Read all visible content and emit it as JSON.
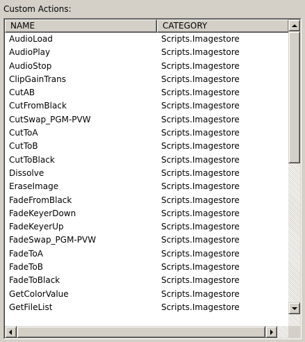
{
  "group_label": "Custom Actions:",
  "columns": {
    "name": "NAME",
    "category": "CATEGORY"
  },
  "rows": [
    {
      "name": "AudioLoad",
      "category": "Scripts.Imagestore"
    },
    {
      "name": "AudioPlay",
      "category": "Scripts.Imagestore"
    },
    {
      "name": "AudioStop",
      "category": "Scripts.Imagestore"
    },
    {
      "name": "ClipGainTrans",
      "category": "Scripts.Imagestore"
    },
    {
      "name": "CutAB",
      "category": "Scripts.Imagestore"
    },
    {
      "name": "CutFromBlack",
      "category": "Scripts.Imagestore"
    },
    {
      "name": "CutSwap_PGM-PVW",
      "category": "Scripts.Imagestore"
    },
    {
      "name": "CutToA",
      "category": "Scripts.Imagestore"
    },
    {
      "name": "CutToB",
      "category": "Scripts.Imagestore"
    },
    {
      "name": "CutToBlack",
      "category": "Scripts.Imagestore"
    },
    {
      "name": "Dissolve",
      "category": "Scripts.Imagestore"
    },
    {
      "name": "EraseImage",
      "category": "Scripts.Imagestore"
    },
    {
      "name": "FadeFromBlack",
      "category": "Scripts.Imagestore"
    },
    {
      "name": "FadeKeyerDown",
      "category": "Scripts.Imagestore"
    },
    {
      "name": "FadeKeyerUp",
      "category": "Scripts.Imagestore"
    },
    {
      "name": "FadeSwap_PGM-PVW",
      "category": "Scripts.Imagestore"
    },
    {
      "name": "FadeToA",
      "category": "Scripts.Imagestore"
    },
    {
      "name": "FadeToB",
      "category": "Scripts.Imagestore"
    },
    {
      "name": "FadeToBlack",
      "category": "Scripts.Imagestore"
    },
    {
      "name": "GetColorValue",
      "category": "Scripts.Imagestore"
    },
    {
      "name": "GetFileList",
      "category": "Scripts.Imagestore"
    }
  ],
  "icons": {
    "scroll_up": "arrow-up-icon",
    "scroll_down": "arrow-down-icon",
    "scroll_left": "arrow-left-icon",
    "scroll_right": "arrow-right-icon"
  },
  "colors": {
    "face": "#d4d0c8",
    "list_bg": "#ffffff",
    "text": "#000000"
  }
}
